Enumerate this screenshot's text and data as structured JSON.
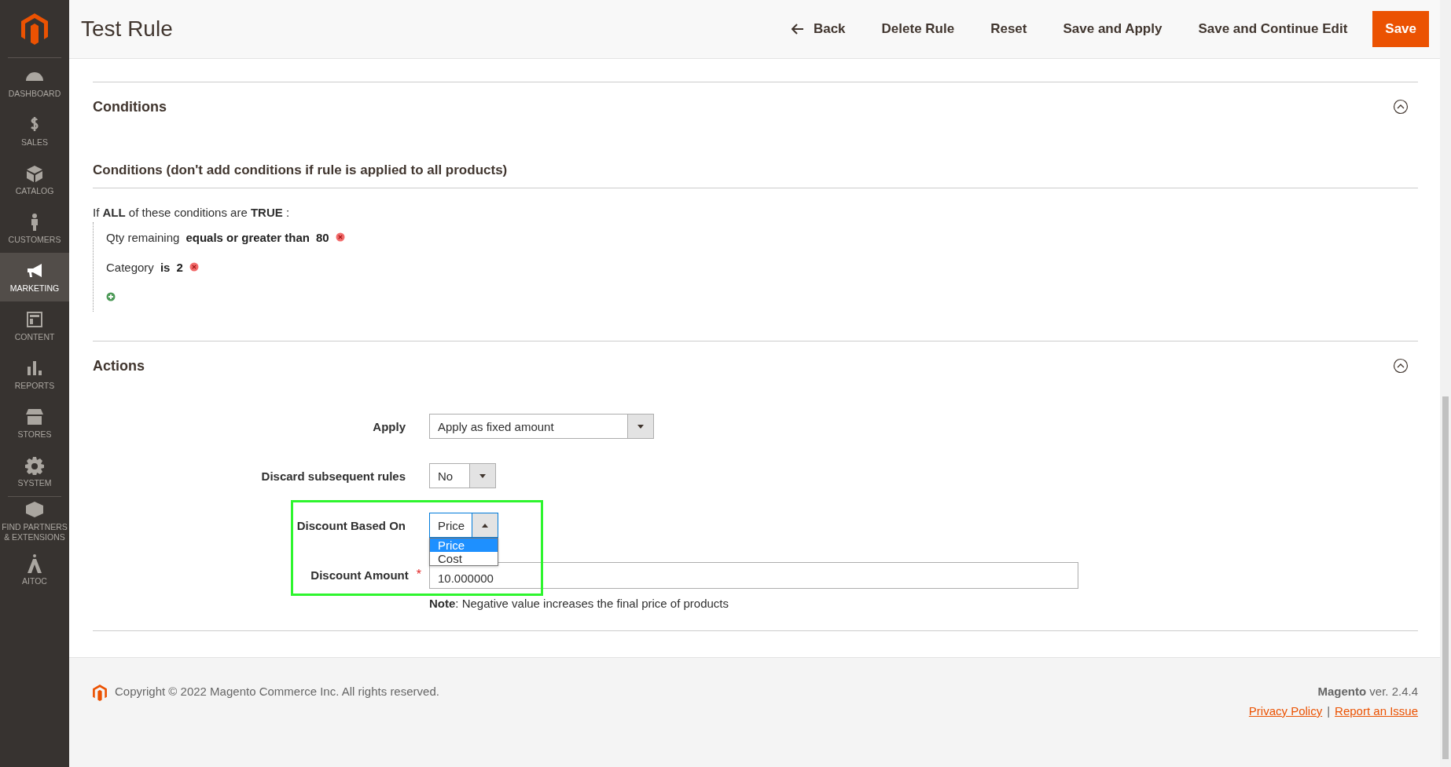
{
  "sidebar": {
    "items": [
      {
        "label": "DASHBOARD",
        "selected": false
      },
      {
        "label": "SALES",
        "selected": false
      },
      {
        "label": "CATALOG",
        "selected": false
      },
      {
        "label": "CUSTOMERS",
        "selected": false
      },
      {
        "label": "MARKETING",
        "selected": true
      },
      {
        "label": "CONTENT",
        "selected": false
      },
      {
        "label": "REPORTS",
        "selected": false
      },
      {
        "label": "STORES",
        "selected": false
      },
      {
        "label": "SYSTEM",
        "selected": false
      },
      {
        "label": "FIND PARTNERS & EXTENSIONS",
        "selected": false
      },
      {
        "label": "AITOC",
        "selected": false
      }
    ]
  },
  "header": {
    "title": "Test Rule",
    "actions": [
      {
        "label": "Back",
        "kind": "back"
      },
      {
        "label": "Delete Rule",
        "kind": "plain"
      },
      {
        "label": "Reset",
        "kind": "plain"
      },
      {
        "label": "Save and Apply",
        "kind": "plain"
      },
      {
        "label": "Save and Continue Edit",
        "kind": "plain"
      },
      {
        "label": "Save",
        "kind": "primary"
      }
    ]
  },
  "conditions": {
    "title": "Conditions",
    "expanded": true,
    "subtitle": "Conditions (don't add conditions if rule is applied to all products)",
    "intro": "If **ALL**  of these conditions are **TRUE** :",
    "rules": [
      {
        "attribute": "Qty remaining",
        "operator": "equals or greater than",
        "value": "80"
      },
      {
        "attribute": "Category",
        "operator": "is",
        "value": "2"
      }
    ]
  },
  "actions": {
    "title": "Actions",
    "expanded": true,
    "fields": [
      {
        "kind": "select",
        "label": "Apply",
        "value": "Apply as fixed amount",
        "open": false
      },
      {
        "kind": "select",
        "label": "Discard subsequent rules",
        "value": "No",
        "open": false
      },
      {
        "kind": "select",
        "label": "Discount Based On",
        "value": "Price",
        "open": true,
        "options": [
          {
            "label": "Price",
            "selected": true
          },
          {
            "label": "Cost",
            "selected": false
          }
        ]
      },
      {
        "kind": "text",
        "label": "Discount Amount",
        "required_mark": "*",
        "value": "10.000000",
        "note": "**Note**: Negative value increases the final price of products"
      }
    ]
  },
  "footer": {
    "copyright": "Copyright © 2022 Magento Commerce Inc. All rights reserved.",
    "version": "**Magento** ver. 2.4.4",
    "links": [
      "Privacy Policy",
      "Report an Issue"
    ],
    "separator": "|"
  }
}
